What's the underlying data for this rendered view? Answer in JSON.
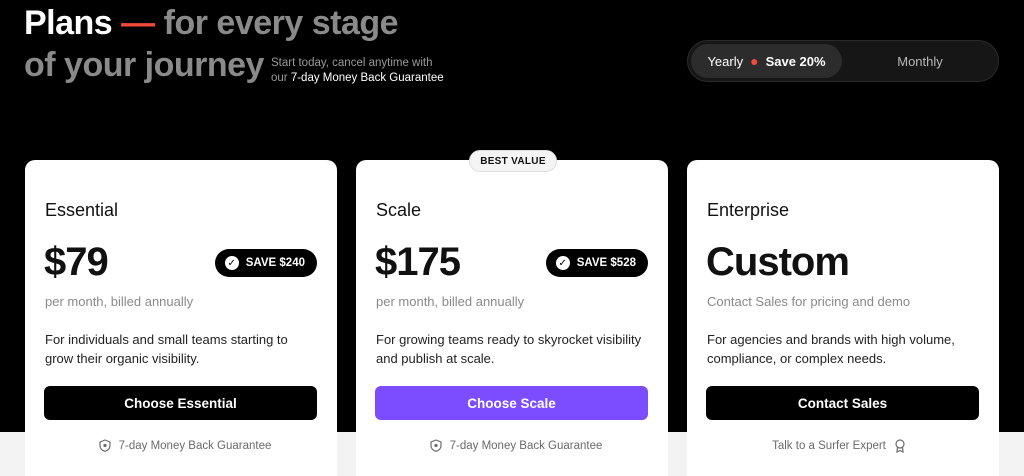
{
  "header": {
    "headline_word1": "Plans",
    "headline_dash": "—",
    "headline_rest": "for every stage",
    "headline_line2": "of your journey",
    "subtext_line1": "Start today, cancel anytime with",
    "subtext_prefix": "our",
    "subtext_bold": "7-day Money Back Guarantee"
  },
  "billing_toggle": {
    "yearly_label": "Yearly",
    "yearly_save": "Save 20%",
    "monthly_label": "Monthly",
    "selected": "Yearly"
  },
  "best_value_badge": "BEST VALUE",
  "plans": [
    {
      "name": "Essential",
      "price": "$79",
      "save_badge": "SAVE $240",
      "price_note": "per month, billed annually",
      "description": "For individuals and small teams starting to grow their organic visibility.",
      "cta_label": "Choose Essential",
      "footer_text": "7-day Money Back Guarantee"
    },
    {
      "name": "Scale",
      "price": "$175",
      "save_badge": "SAVE $528",
      "price_note": "per month, billed annually",
      "description": "For growing teams ready to skyrocket visibility and publish at scale.",
      "cta_label": "Choose Scale",
      "footer_text": "7-day Money Back Guarantee"
    },
    {
      "name": "Enterprise",
      "price": "Custom",
      "price_note": "Contact Sales for pricing and demo",
      "description": "For agencies and brands with high volume, compliance, or complex needs.",
      "cta_label": "Contact Sales",
      "footer_text": "Talk to a Surfer Expert"
    }
  ],
  "colors": {
    "accent_red": "#ef4a3a",
    "cta_purple": "#7c4dff",
    "cta_black": "#000000"
  },
  "icons": {
    "save_badge": "check-circle-icon",
    "guarantee": "shield-icon",
    "expert": "award-icon"
  }
}
